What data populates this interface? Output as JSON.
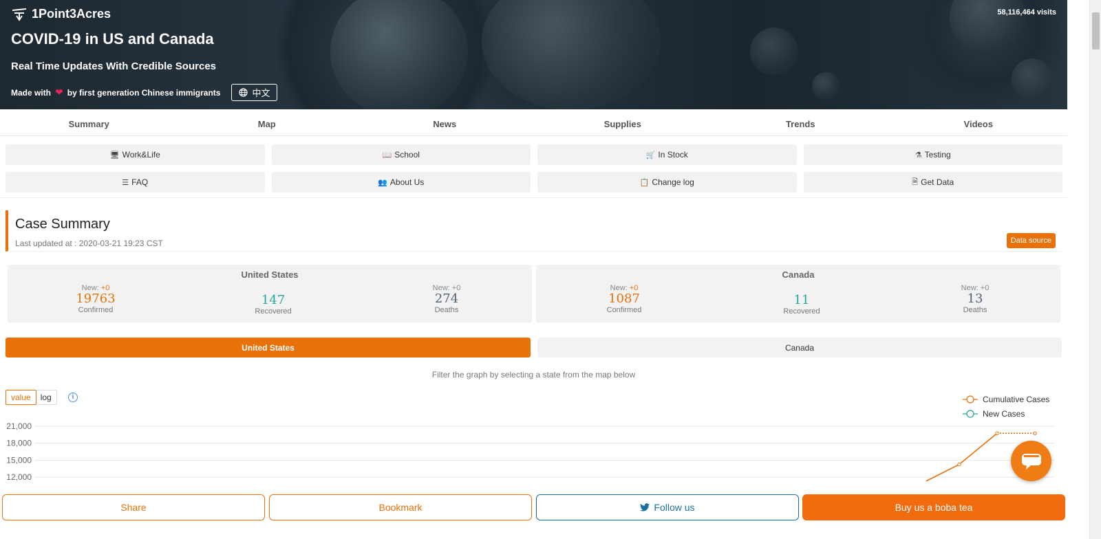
{
  "header": {
    "brand": "1Point3Acres",
    "title": "COVID-19 in US and Canada",
    "subtitle": "Real Time Updates With Credible Sources",
    "made_prefix": "Made with",
    "made_suffix": "by first generation Chinese immigrants",
    "lang_button": "中文",
    "visits": "58,116,464 visits"
  },
  "nav": {
    "tabs": [
      "Summary",
      "Map",
      "News",
      "Supplies",
      "Trends",
      "Videos"
    ]
  },
  "subnav": {
    "items": [
      {
        "label": "Work&Life",
        "icon": "monitor-icon"
      },
      {
        "label": "School",
        "icon": "book-icon"
      },
      {
        "label": "In Stock",
        "icon": "cart-icon"
      },
      {
        "label": "Testing",
        "icon": "flask-icon"
      },
      {
        "label": "FAQ",
        "icon": "list-icon"
      },
      {
        "label": "About Us",
        "icon": "team-icon"
      },
      {
        "label": "Change log",
        "icon": "copy-icon"
      },
      {
        "label": "Get Data",
        "icon": "document-icon"
      }
    ]
  },
  "summary": {
    "title": "Case Summary",
    "updated": "Last updated at : 2020-03-21 19:23 CST",
    "data_source": "Data source",
    "countries": [
      {
        "name": "United States",
        "confirmed": {
          "new_label": "New:",
          "new": "+0",
          "value": "19763",
          "label": "Confirmed"
        },
        "recovered": {
          "value": "147",
          "label": "Recovered"
        },
        "deaths": {
          "new_label": "New:",
          "new": "+0",
          "value": "274",
          "label": "Deaths"
        }
      },
      {
        "name": "Canada",
        "confirmed": {
          "new_label": "New:",
          "new": "+0",
          "value": "1087",
          "label": "Confirmed"
        },
        "recovered": {
          "value": "11",
          "label": "Recovered"
        },
        "deaths": {
          "new_label": "New:",
          "new": "+0",
          "value": "13",
          "label": "Deaths"
        }
      }
    ]
  },
  "toggle": {
    "us": "United States",
    "ca": "Canada"
  },
  "filter_hint": "Filter the graph by selecting a state from the map below",
  "scale": {
    "value": "value",
    "log": "log",
    "info": "i"
  },
  "chart_data": {
    "type": "line",
    "yticks": [
      "21,000",
      "18,000",
      "15,000",
      "12,000"
    ],
    "legend": [
      "Cumulative Cases",
      "New Cases"
    ],
    "legend_position": "top-right",
    "series": [
      {
        "name": "Cumulative Cases",
        "color": "#e8710a",
        "values": [
          11300,
          14250,
          19763,
          19763
        ]
      }
    ]
  },
  "bottom": {
    "share": "Share",
    "bookmark": "Bookmark",
    "follow": "Follow us",
    "boba": "Buy us a boba tea"
  },
  "colors": {
    "accent": "#e8710a",
    "teal": "#26a69a",
    "twitter": "#1b6f9e"
  }
}
